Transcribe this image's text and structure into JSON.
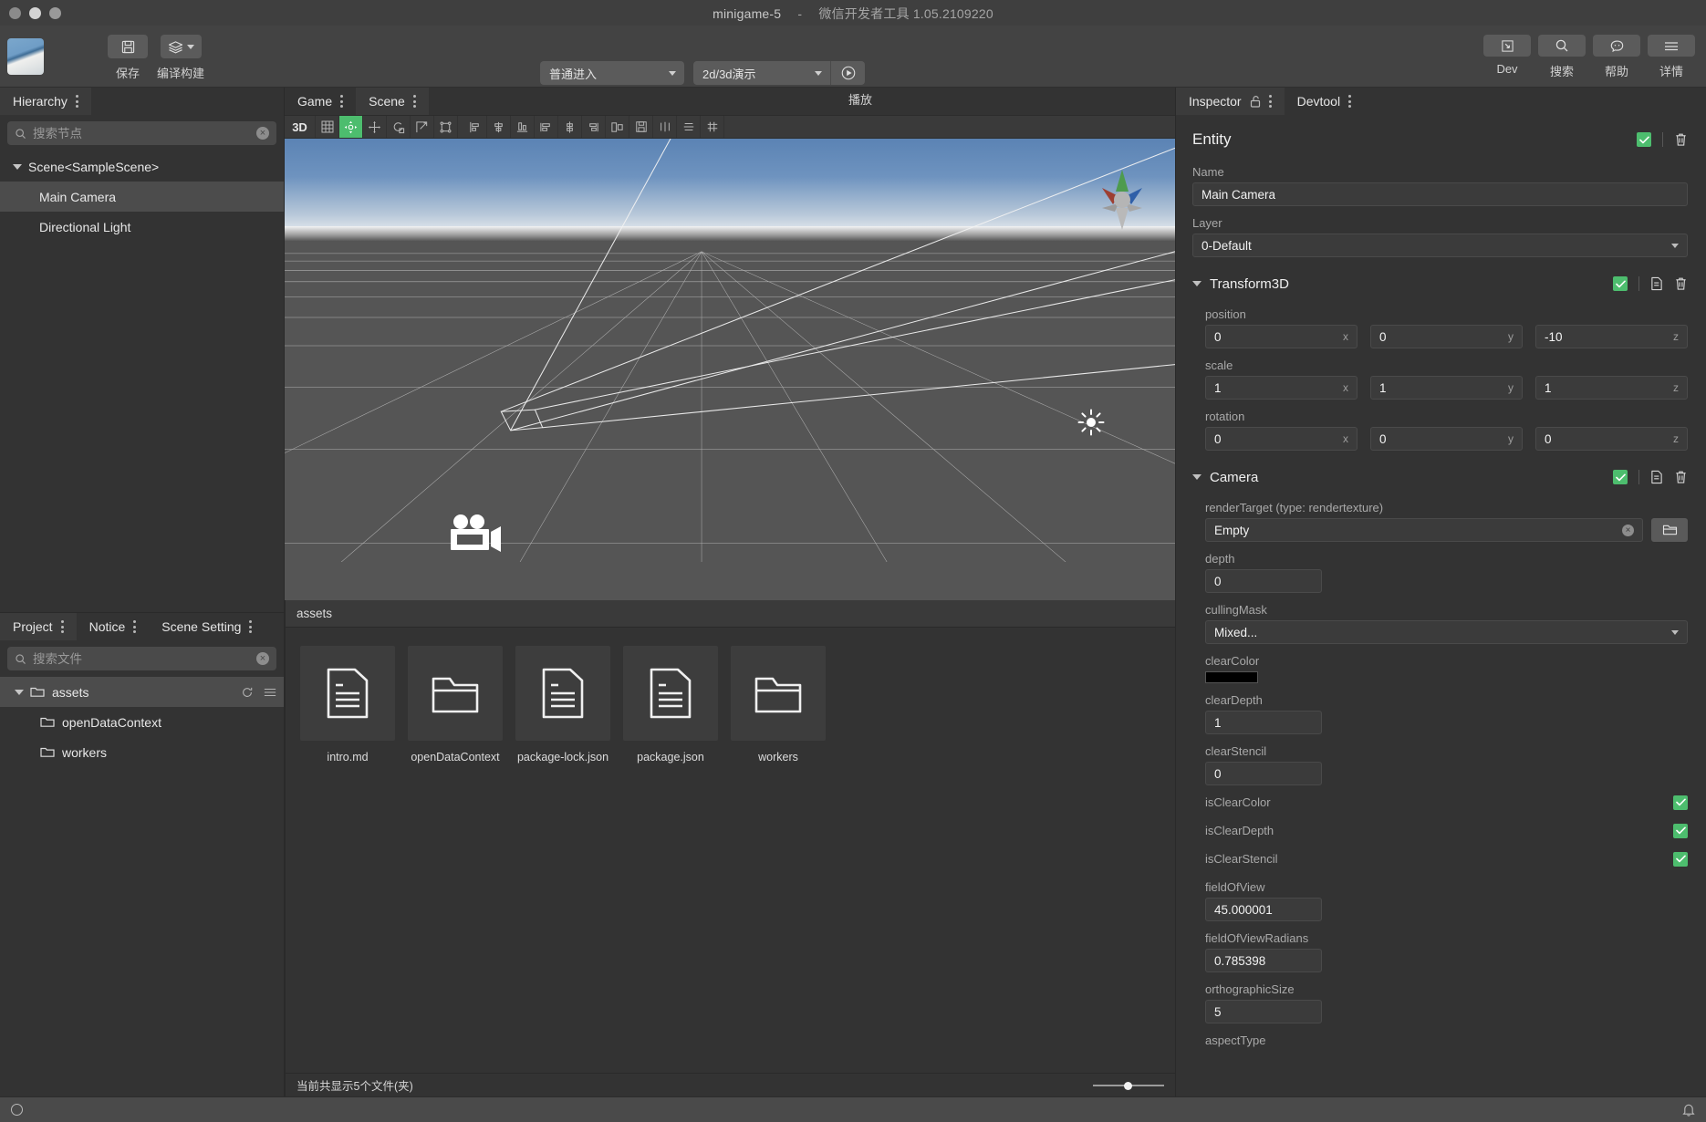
{
  "window": {
    "project_name": "minigame-5",
    "separator": "-",
    "app_name": "微信开发者工具 1.05.2109220"
  },
  "toolbar": {
    "left": [
      {
        "label": "保存",
        "icon": "save-icon"
      },
      {
        "label": "编译构建",
        "icon": "layers-icon",
        "has_caret": true
      }
    ],
    "center": {
      "mode_select": "普通进入",
      "scene_select": "2d/3d演示",
      "play_icon": "play-icon",
      "play_label": "播放"
    },
    "right": [
      {
        "label": "Dev",
        "icon": "devtools-icon"
      },
      {
        "label": "搜索",
        "icon": "search-icon"
      },
      {
        "label": "帮助",
        "icon": "help-chat-icon"
      },
      {
        "label": "详情",
        "icon": "hamburger-icon"
      }
    ]
  },
  "hierarchy": {
    "tab_label": "Hierarchy",
    "search_placeholder": "搜索节点",
    "search_value": "",
    "nodes": [
      {
        "label": "Scene<SampleScene>",
        "depth": 0,
        "expandable": true,
        "selected": false
      },
      {
        "label": "Main Camera",
        "depth": 1,
        "expandable": false,
        "selected": true
      },
      {
        "label": "Directional Light",
        "depth": 1,
        "expandable": false,
        "selected": false
      }
    ]
  },
  "scene_tabs": [
    {
      "label": "Game",
      "active": false
    },
    {
      "label": "Scene",
      "active": true
    }
  ],
  "scene_toolbar": {
    "mode_label": "3D",
    "tools": [
      {
        "name": "grid-toggle-icon",
        "active": false
      },
      {
        "name": "move-gizmo-icon",
        "active": true
      },
      {
        "name": "pan-gizmo-icon",
        "active": false
      },
      {
        "name": "rotate-gizmo-icon",
        "active": false
      },
      {
        "name": "scale-gizmo-icon",
        "active": false
      },
      {
        "name": "rect-transform-icon",
        "active": false
      },
      {
        "name": "align-left-edge-icon",
        "active": false
      },
      {
        "name": "align-center-horizontal-icon",
        "active": false
      },
      {
        "name": "align-bottom-edge-icon",
        "active": false
      },
      {
        "name": "align-left-icon",
        "active": false
      },
      {
        "name": "align-center-vertical-icon",
        "active": false
      },
      {
        "name": "align-right-icon",
        "active": false
      },
      {
        "name": "distribute-icon",
        "active": false
      },
      {
        "name": "save-layout-icon",
        "active": false
      },
      {
        "name": "columns-icon",
        "active": false
      },
      {
        "name": "rows-icon",
        "active": false
      },
      {
        "name": "grid-snap-icon",
        "active": false
      }
    ]
  },
  "viewport": {
    "camera_gizmo_label": "camera-icon",
    "light_gizmo_label": "sun-icon",
    "axis_gizmo_label": "axis-gizmo"
  },
  "project": {
    "tabs": [
      {
        "label": "Project",
        "active": true
      },
      {
        "label": "Notice",
        "active": false
      },
      {
        "label": "Scene Setting",
        "active": false
      }
    ],
    "search_placeholder": "搜索文件",
    "search_value": "",
    "tree": [
      {
        "label": "assets",
        "depth": 0,
        "expandable": true,
        "selected": true,
        "has_row_icons": true
      },
      {
        "label": "openDataContext",
        "depth": 1,
        "expandable": false,
        "selected": false,
        "has_row_icons": false
      },
      {
        "label": "workers",
        "depth": 1,
        "expandable": false,
        "selected": false,
        "has_row_icons": false
      }
    ]
  },
  "assets": {
    "breadcrumb": "assets",
    "items": [
      {
        "name": "intro.md",
        "type": "file"
      },
      {
        "name": "openDataContext",
        "type": "folder"
      },
      {
        "name": "package-lock.json",
        "type": "file"
      },
      {
        "name": "package.json",
        "type": "file"
      },
      {
        "name": "workers",
        "type": "folder"
      }
    ],
    "status": "当前共显示5个文件(夹)"
  },
  "inspector": {
    "tabs": [
      {
        "label": "Inspector",
        "active": true,
        "has_lock": true
      },
      {
        "label": "Devtool",
        "active": false,
        "has_lock": false
      }
    ],
    "entity": {
      "title": "Entity",
      "name_label": "Name",
      "name_value": "Main Camera",
      "layer_label": "Layer",
      "layer_value": "0-Default"
    },
    "transform": {
      "title": "Transform3D",
      "position_label": "position",
      "position": {
        "x": "0",
        "y": "0",
        "z": "-10"
      },
      "scale_label": "scale",
      "scale": {
        "x": "1",
        "y": "1",
        "z": "1"
      },
      "rotation_label": "rotation",
      "rotation": {
        "x": "0",
        "y": "0",
        "z": "0"
      },
      "axis_x": "x",
      "axis_y": "y",
      "axis_z": "z"
    },
    "camera": {
      "title": "Camera",
      "render_target_label": "renderTarget (type: rendertexture)",
      "render_target_value": "Empty",
      "depth_label": "depth",
      "depth_value": "0",
      "culling_mask_label": "cullingMask",
      "culling_mask_value": "Mixed...",
      "clear_color_label": "clearColor",
      "clear_color_value": "#000000",
      "clear_depth_label": "clearDepth",
      "clear_depth_value": "1",
      "clear_stencil_label": "clearStencil",
      "clear_stencil_value": "0",
      "is_clear_color_label": "isClearColor",
      "is_clear_depth_label": "isClearDepth",
      "is_clear_stencil_label": "isClearStencil",
      "field_of_view_label": "fieldOfView",
      "field_of_view_value": "45.000001",
      "field_of_view_radians_label": "fieldOfViewRadians",
      "field_of_view_radians_value": "0.785398",
      "orthographic_size_label": "orthographicSize",
      "orthographic_size_value": "5",
      "aspect_type_label": "aspectType"
    }
  },
  "colors": {
    "accent_green": "#4dbd6e",
    "panel_bg": "#333333",
    "toolbar_bg": "#434343",
    "input_bg": "#3b3b3b"
  },
  "statusbar": {
    "indicator": "idle-circle",
    "bell": "bell-icon"
  }
}
